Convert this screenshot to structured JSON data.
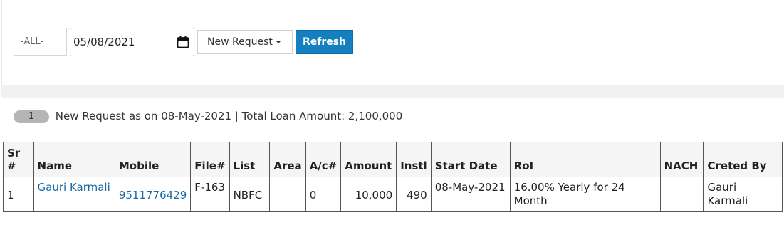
{
  "filters": {
    "all_option": "-ALL-",
    "date_value": "05/08/2021",
    "request_type": "New Request",
    "refresh_label": "Refresh"
  },
  "summary": {
    "count": "1",
    "text": "New Request as on 08-May-2021 | Total Loan Amount: 2,100,000"
  },
  "table": {
    "headers": [
      "Sr #",
      "Name",
      "Mobile",
      "File#",
      "List",
      "Area",
      "A/c#",
      "Amount",
      "Instl",
      "Start Date",
      "RoI",
      "NACH",
      "Creted By"
    ],
    "rows": [
      {
        "sr": "1",
        "name": "Gauri Karmali",
        "mobile": "9511776429",
        "file": "F-163",
        "list": "NBFC",
        "area": "",
        "account": "0",
        "amount": "10,000",
        "instl": "490",
        "start_date": "08-May-2021",
        "roi": "16.00% Yearly for 24 Month",
        "nach": "",
        "created_by": "Gauri Karmali"
      }
    ]
  }
}
